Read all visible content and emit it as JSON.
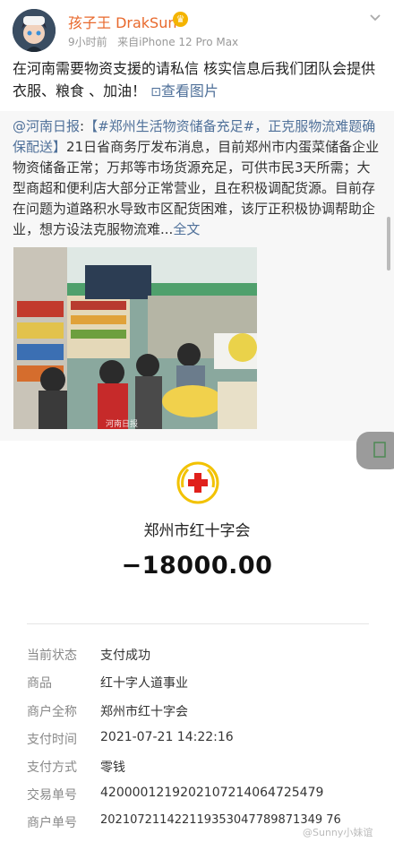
{
  "post": {
    "username": "孩子王 DrakSun",
    "time": "9小时前",
    "source": "来自iPhone 12 Pro Max",
    "text": "在河南需要物资支援的请私信 核实信息后我们团队会提供衣服、粮食 、加油！",
    "view_image": "查看图片",
    "repost": {
      "author": "@河南日报",
      "tag": "【#郑州生活物资储备充足#，正克服物流难题确保配送】",
      "body": "21日省商务厅发布消息，目前郑州市内蛋菜储备企业物资储备正常；万邦等市场货源充足，可供市民3天所需；大型商超和便利店大部分正常营业，且在积极调配货源。目前存在问题为道路积水导致市区配货困难，该厅正积极协调帮助企业，想方设法克服物流难...",
      "full_text": "全文",
      "image_watermark": "河南日报"
    }
  },
  "receipt": {
    "payee": "郑州市红十字会",
    "amount": "−18000.00",
    "rows": [
      {
        "label": "当前状态",
        "value": "支付成功"
      },
      {
        "label": "商品",
        "value": "红十字人道事业"
      },
      {
        "label": "商户全称",
        "value": "郑州市红十字会"
      },
      {
        "label": "支付时间",
        "value": "2021-07-21 14:22:16"
      },
      {
        "label": "支付方式",
        "value": "零钱"
      },
      {
        "label": "交易单号",
        "value": "4200001219202107214064725479"
      },
      {
        "label": "商户单号",
        "value": "202107211422119353047789871349 76"
      }
    ],
    "watermark": "@Sunny小妹谊"
  },
  "icons": {
    "avatar": "avatar-image",
    "badge": "crown-icon",
    "more": "chevron-down-icon",
    "image": "image-icon",
    "logo": "red-cross-icon"
  },
  "colors": {
    "username": "#e8692d",
    "link": "#50719a",
    "repost_bg": "#f7f7f7",
    "cross_red": "#e0201b",
    "logo_gold": "#f2c200"
  }
}
